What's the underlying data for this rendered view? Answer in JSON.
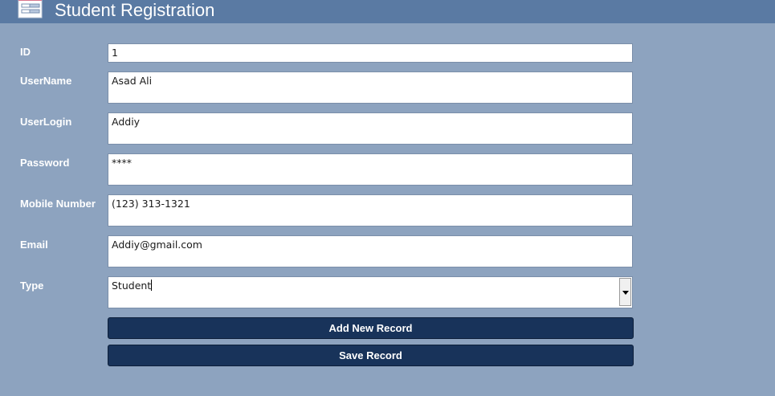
{
  "header": {
    "title": "Student Registration",
    "icon": "form-icon"
  },
  "form": {
    "fields": [
      {
        "label": "ID",
        "value": "1"
      },
      {
        "label": "UserName",
        "value": "Asad Ali"
      },
      {
        "label": "UserLogin",
        "value": "Addiy"
      },
      {
        "label": "Password",
        "value": "****"
      },
      {
        "label": "Mobile Number",
        "value": "(123) 313-1321"
      },
      {
        "label": "Email",
        "value": "Addiy@gmail.com"
      },
      {
        "label": "Type",
        "value": "Student"
      }
    ]
  },
  "buttons": {
    "add_new_record": "Add New Record",
    "save_record": "Save Record"
  },
  "colors": {
    "background": "#8da3bf",
    "header": "#5a7aa3",
    "button": "#18335a"
  }
}
